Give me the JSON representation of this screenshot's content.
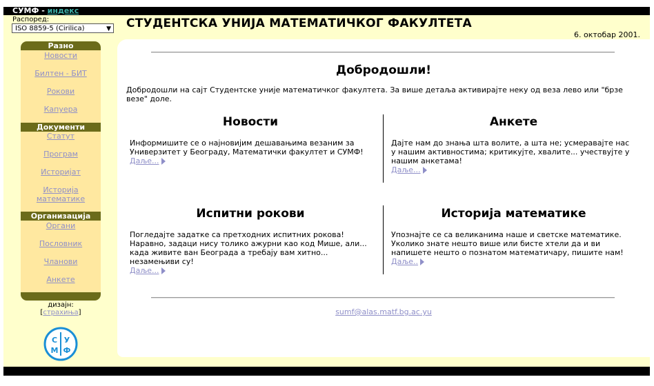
{
  "header": {
    "site_name": "СУМФ",
    "separator": " - ",
    "index_link": "индекс",
    "title": "СТУДЕНТСКА УНИЈА МАТЕМАТИЧКОГ ФАКУЛТЕТА",
    "date": "6. октобар 2001."
  },
  "schedule": {
    "label": "Распоред:",
    "selected": "ISO 8859-5 (Cirilica)"
  },
  "sidebar": {
    "caption": "Разно",
    "misc_items": [
      {
        "label": "Новости"
      },
      {
        "label": "Билтен - БИТ"
      },
      {
        "label": "Рокови"
      },
      {
        "label": "Капуера"
      }
    ],
    "documents_header": "Документи",
    "document_items": [
      {
        "label": "Статут"
      },
      {
        "label": "Програм"
      },
      {
        "label": "Историјат"
      },
      {
        "label": "Историја математике"
      }
    ],
    "organization_header": "Организација",
    "organization_items": [
      {
        "label": "Органи"
      },
      {
        "label": "Пословник"
      },
      {
        "label": "Чланови"
      },
      {
        "label": "Анкете"
      }
    ]
  },
  "design": {
    "label": "дизајн:",
    "bracket_open": "[",
    "author": "страхиња",
    "bracket_close": "]"
  },
  "logo": {
    "letters": [
      "С",
      "У",
      "М",
      "Ф"
    ],
    "color": "#1a8fd6"
  },
  "main": {
    "welcome_title": "Добродошли!",
    "welcome_text": "Добродошли на сајт Студентске уније математичког факултета. За више детаља активирајте неку од веза лево или \"брзе везе\" доле.",
    "sections": [
      {
        "title": "Новости",
        "text": "Информишите се о најновијим дешавањима везаним за Универзитет у Београду, Математички факултет и СУМФ!",
        "more": "Даље..."
      },
      {
        "title": "Анкете",
        "text": "Дајте нам до знања шта волите, а шта не; усмеравајте нас у нашим активностима; критикујте, хвалите... учествујте у нашим анкетама!",
        "more": "Даље..."
      },
      {
        "title": "Испитни рокови",
        "text": "Погледајте задатке са претходних испитних рокова! Наравно, задаци нису толико ажурни као код Мише, али... када живите ван Београда а требају вам хитно... незамењиви су!",
        "more": "Даље..."
      },
      {
        "title": "Историја математике",
        "text": "Упознајте се са великанима наше и светске математике. Уколико знате нешто више или бисте хтели да и ви напишете нешто о познатом математичару, пишите нам!",
        "more": "Даље.."
      }
    ],
    "email": "sumf@alas.matf.bg.ac.yu"
  }
}
